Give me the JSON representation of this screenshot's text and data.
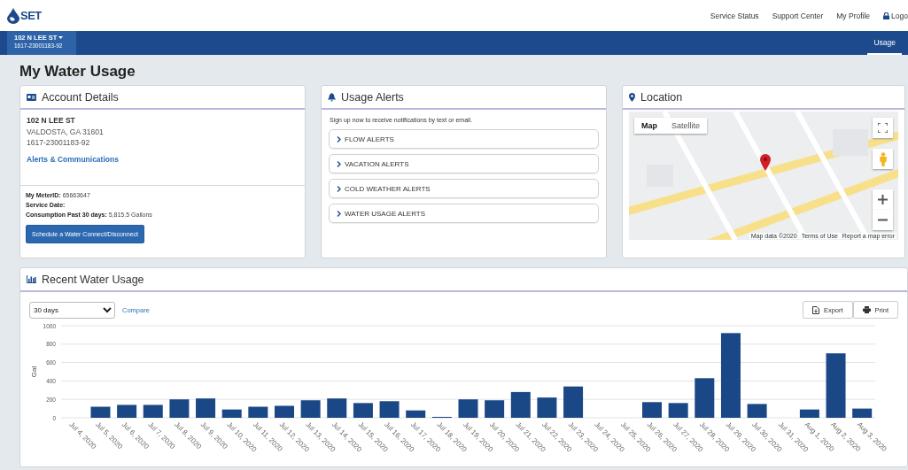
{
  "header": {
    "logo": "SET",
    "links": [
      "Service Status",
      "Support Center",
      "My Profile",
      "Logo"
    ]
  },
  "nav": {
    "account": {
      "address": "102 N LEE ST",
      "number": "1617-23001183-92"
    },
    "tabs": [
      {
        "label": "Usage",
        "selected": true
      }
    ]
  },
  "page_title": "My Water Usage",
  "account_details": {
    "title": "Account Details",
    "address_line_1": "102 N LEE ST",
    "address_line_2": "VALDOSTA, GA 31601",
    "account_number": "1617-23001183-92",
    "link": "Alerts & Communications",
    "meter_line": "**My MeterID:** 65663647",
    "service_date_label": "Service Date:",
    "consumption_line": "**Consumption Past 30 days:** 5,815.5 Gallons",
    "button": "Schedule a Water Connect/Disconnect"
  },
  "usage_alerts": {
    "title": "Usage Alerts",
    "intro": "Sign up now to receive notifications by text or email.",
    "alerts": [
      {
        "label": "FLOW ALERTS",
        "expanded": false
      },
      {
        "label": "VACATION ALERTS",
        "expanded": false
      },
      {
        "label": "COLD WEATHER ALERTS",
        "expanded": false
      },
      {
        "label": "WATER USAGE ALERTS",
        "expanded": false
      }
    ]
  },
  "location": {
    "title": "Location",
    "map_types": [
      {
        "label": "Map",
        "selected": true
      },
      {
        "label": "Satellite",
        "selected": false
      }
    ],
    "attribution": [
      "Map data ©2020",
      "Terms of Use",
      "Report a map error"
    ]
  },
  "recent_usage": {
    "title": "Recent Water Usage",
    "range_select": {
      "value": "30 days"
    },
    "compare_link": "Compare",
    "buttons": [
      "Export",
      "Print"
    ],
    "chart_data": {
      "type": "bar",
      "grid": true,
      "ylabel": "Gal",
      "ylim": [
        0,
        1000
      ],
      "yticks": [
        0,
        200,
        400,
        600,
        800,
        1000
      ],
      "categories": [
        "Jul 4, 2020",
        "Jul 5, 2020",
        "Jul 6, 2020",
        "Jul 7, 2020",
        "Jul 8, 2020",
        "Jul 9, 2020",
        "Jul 10, 2020",
        "Jul 11, 2020",
        "Jul 12, 2020",
        "Jul 13, 2020",
        "Jul 14, 2020",
        "Jul 15, 2020",
        "Jul 16, 2020",
        "Jul 17, 2020",
        "Jul 18, 2020",
        "Jul 19, 2020",
        "Jul 20, 2020",
        "Jul 21, 2020",
        "Jul 22, 2020",
        "Jul 23, 2020",
        "Jul 24, 2020",
        "Jul 25, 2020",
        "Jul 26, 2020",
        "Jul 27, 2020",
        "Jul 28, 2020",
        "Jul 29, 2020",
        "Jul 30, 2020",
        "Jul 31, 2020",
        "Aug 1, 2020",
        "Aug 2, 2020",
        "Aug 3, 2020"
      ],
      "values": [
        0,
        120,
        140,
        140,
        200,
        210,
        90,
        120,
        130,
        190,
        210,
        160,
        180,
        80,
        10,
        200,
        190,
        280,
        220,
        340,
        0,
        0,
        170,
        160,
        430,
        920,
        150,
        0,
        90,
        700,
        100
      ]
    }
  }
}
